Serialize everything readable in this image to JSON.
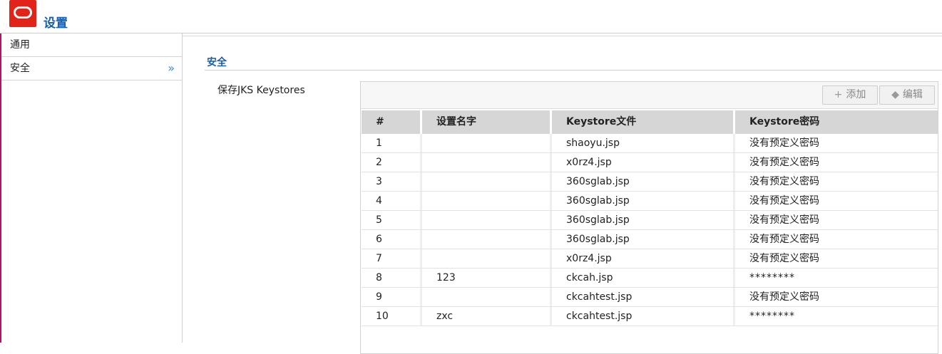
{
  "app": {
    "title": "设置",
    "logo_icon": "oracle-ring-icon",
    "brand_color": "#e2231a",
    "title_color": "#1660b3"
  },
  "sidebar": {
    "items": [
      {
        "label": "通用",
        "active": false
      },
      {
        "label": "安全",
        "active": true,
        "chevron": "»"
      }
    ]
  },
  "main": {
    "section_title": "安全",
    "field_label": "保存JKS Keystores",
    "toolbar": {
      "add_icon": "plus-icon",
      "add_glyph": "+",
      "add_label": "添加",
      "edit_icon": "tag-icon",
      "edit_glyph": "◆",
      "edit_label": "编辑"
    },
    "table": {
      "columns": [
        "#",
        "设置名字",
        "Keystore文件",
        "Keystore密码"
      ],
      "rows": [
        [
          "1",
          "",
          "shaoyu.jsp",
          "没有预定义密码"
        ],
        [
          "2",
          "",
          "x0rz4.jsp",
          "没有预定义密码"
        ],
        [
          "3",
          "",
          "360sglab.jsp",
          "没有预定义密码"
        ],
        [
          "4",
          "",
          "360sglab.jsp",
          "没有预定义密码"
        ],
        [
          "5",
          "",
          "360sglab.jsp",
          "没有预定义密码"
        ],
        [
          "6",
          "",
          "360sglab.jsp",
          "没有预定义密码"
        ],
        [
          "7",
          "",
          "x0rz4.jsp",
          "没有预定义密码"
        ],
        [
          "8",
          "123",
          "ckcah.jsp",
          "********"
        ],
        [
          "9",
          "",
          "ckcahtest.jsp",
          "没有预定义密码"
        ],
        [
          "10",
          "zxc",
          "ckcahtest.jsp",
          "********"
        ]
      ]
    }
  }
}
